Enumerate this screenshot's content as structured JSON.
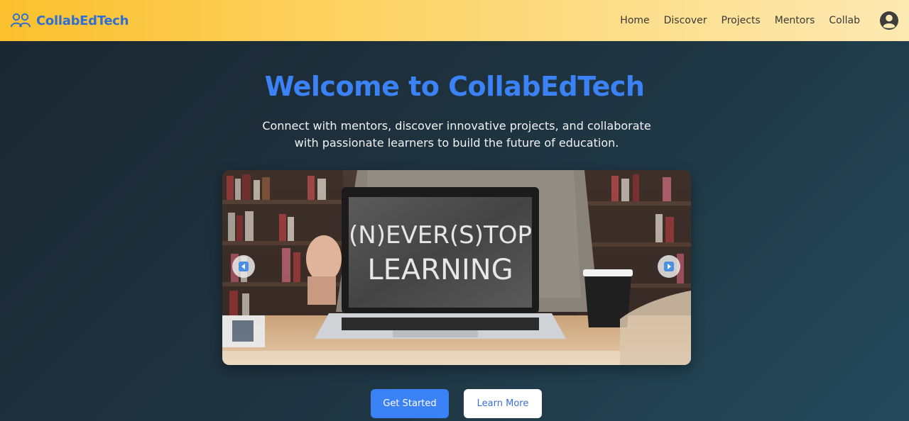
{
  "brand": {
    "name": "CollabEdTech",
    "icon": "users-icon"
  },
  "nav": {
    "links": [
      "Home",
      "Discover",
      "Projects",
      "Mentors",
      "Collab"
    ],
    "profile_icon": "user-circle-icon"
  },
  "hero": {
    "title": "Welcome to CollabEdTech",
    "subtitle": "Connect with mentors, discover innovative projects, and collaborate with passionate learners to build the future of education."
  },
  "carousel": {
    "slide_text_line1": "(N)EVER(S)TOP",
    "slide_text_line2": "LEARNING",
    "prev_icon": "arrow-left-icon",
    "next_icon": "arrow-right-icon"
  },
  "cta": {
    "primary": "Get Started",
    "secondary": "Learn More"
  },
  "colors": {
    "brand_blue": "#3b82f6",
    "nav_gradient_start": "#fbc02d",
    "nav_gradient_end": "#fde9b3",
    "background_dark": "#1b2630"
  }
}
